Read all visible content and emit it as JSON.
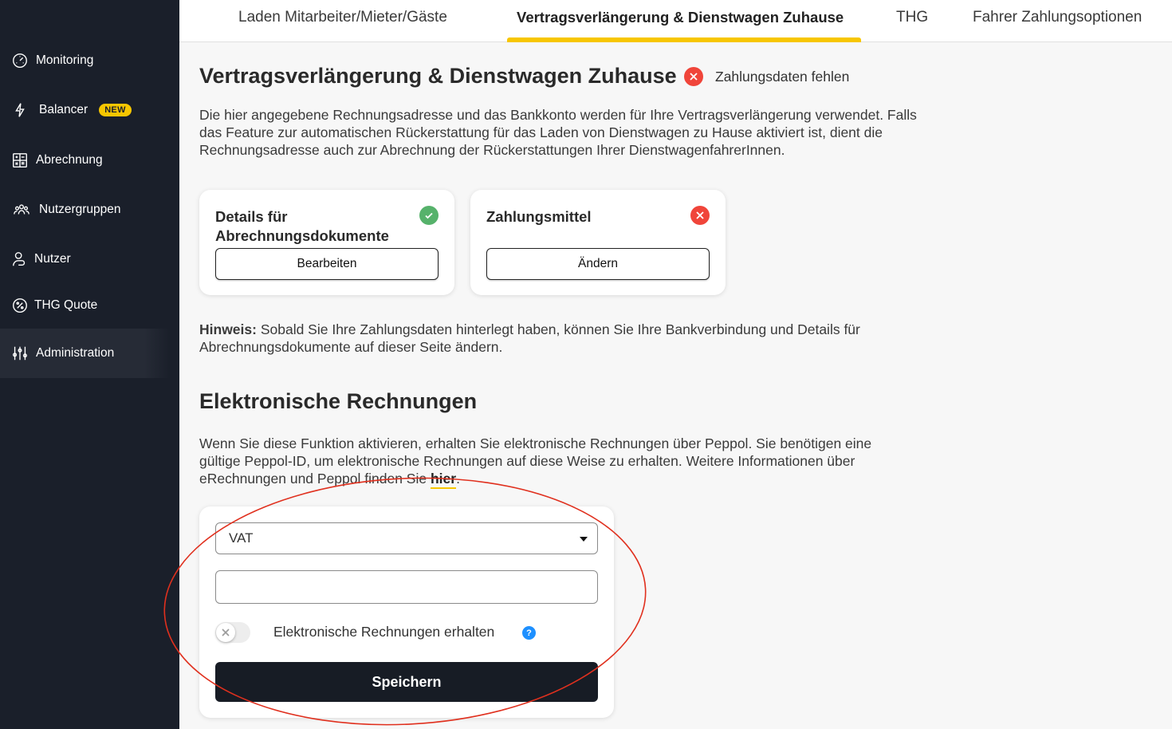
{
  "sidebar": {
    "items": [
      {
        "label": "Monitoring",
        "icon": "gauge-icon"
      },
      {
        "label": "Balancer",
        "icon": "bolt-icon",
        "badge": "NEW"
      },
      {
        "label": "Abrechnung",
        "icon": "calculator-icon"
      },
      {
        "label": "Nutzergruppen",
        "icon": "group-icon"
      },
      {
        "label": "Nutzer",
        "icon": "user-icon"
      },
      {
        "label": "THG Quote",
        "icon": "percent-icon"
      },
      {
        "label": "Administration",
        "icon": "sliders-icon",
        "active": true
      }
    ]
  },
  "tabs": [
    {
      "label": "Laden Mitarbeiter/Mieter/Gäste"
    },
    {
      "label": "Vertragsverlängerung & Dienstwagen Zuhause",
      "active": true
    },
    {
      "label": "THG"
    },
    {
      "label": "Fahrer Zahlungsoptionen"
    }
  ],
  "main": {
    "title": "Vertragsverlängerung & Dienstwagen Zuhause",
    "status_text": "Zahlungsdaten fehlen",
    "intro": "Die hier angegebene Rechnungsadresse und das Bankkonto werden für Ihre Vertragsverlängerung verwendet. Falls das Feature zur automatischen Rückerstattung für das Laden von Dienstwagen zu Hause aktiviert ist, dient die Rechnungsadresse auch zur Abrechnung der Rückerstattungen Ihrer DienstwagenfahrerInnen.",
    "cards": [
      {
        "title": "Details für Abrechnungsdokumente",
        "button": "Bearbeiten",
        "status": "ok"
      },
      {
        "title": "Zahlungsmittel",
        "button": "Ändern",
        "status": "error"
      }
    ],
    "hint_label": "Hinweis:",
    "hint_text": " Sobald Sie Ihre Zahlungsdaten hinterlegt haben, können Sie Ihre Bankverbindung und Details für Abrechnungsdokumente auf dieser Seite ändern."
  },
  "einvoice": {
    "title": "Elektronische Rechnungen",
    "desc": "Wenn Sie diese Funktion aktivieren, erhalten Sie elektronische Rechnungen über Peppol. Sie benötigen eine gültige Peppol-ID, um elektronische Rechnungen auf diese Weise zu erhalten. Weitere Informationen über eRechnungen und Peppol finden Sie ",
    "link": "hier",
    "desc_end": ".",
    "select_value": "VAT",
    "input_value": "",
    "input_placeholder": "",
    "toggle_label": "Elektronische Rechnungen erhalten",
    "toggle_on": false,
    "help": "?",
    "save_button": "Speichern"
  },
  "colors": {
    "sidebar_bg": "#1a1f2a",
    "accent": "#f7c600",
    "error": "#f0453a",
    "success": "#56b26b",
    "annotation": "#e0301e"
  }
}
